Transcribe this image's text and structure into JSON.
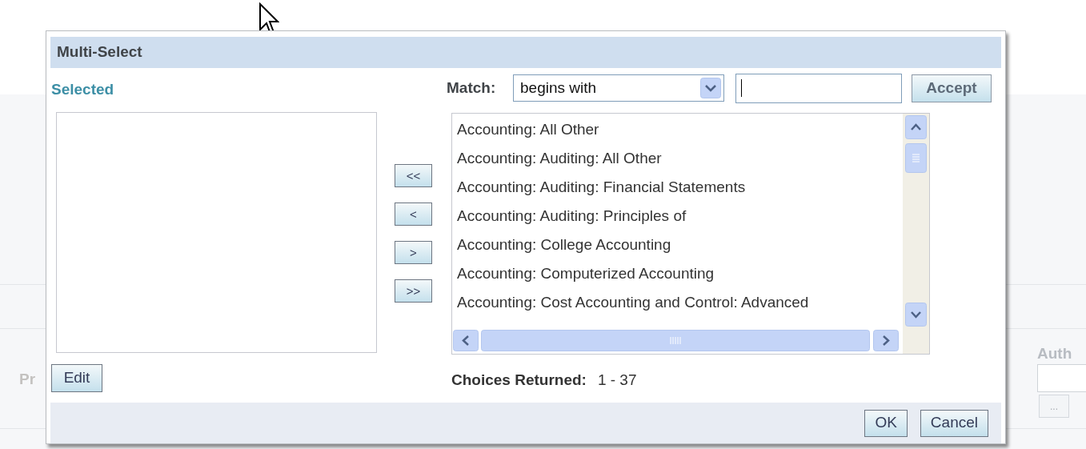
{
  "background": {
    "left_label": "Pr",
    "right_label": "Auth",
    "browse_button": "..."
  },
  "dialog": {
    "title": "Multi-Select",
    "selected_label": "Selected",
    "edit_button": "Edit",
    "move_buttons": [
      "<<",
      "<",
      ">",
      ">>"
    ],
    "match": {
      "label": "Match:",
      "mode": "begins with"
    },
    "accept_button": "Accept",
    "choices": [
      {
        "label": "Accounting: All Other",
        "selected": false
      },
      {
        "label": "Accounting: Auditing: All Other",
        "selected": false
      },
      {
        "label": "Accounting: Auditing: Financial Statements",
        "selected": false
      },
      {
        "label": "Accounting: Auditing: Principles of",
        "selected": false
      },
      {
        "label": "Accounting: College Accounting",
        "selected": false
      },
      {
        "label": "Accounting: Computerized Accounting",
        "selected": false
      },
      {
        "label": "Accounting: Cost Accounting and Control: Advanced",
        "selected": false
      }
    ],
    "choices_returned": {
      "label": "Choices Returned:",
      "value": "1 - 37"
    },
    "buttons": [
      "OK",
      "Cancel"
    ]
  }
}
